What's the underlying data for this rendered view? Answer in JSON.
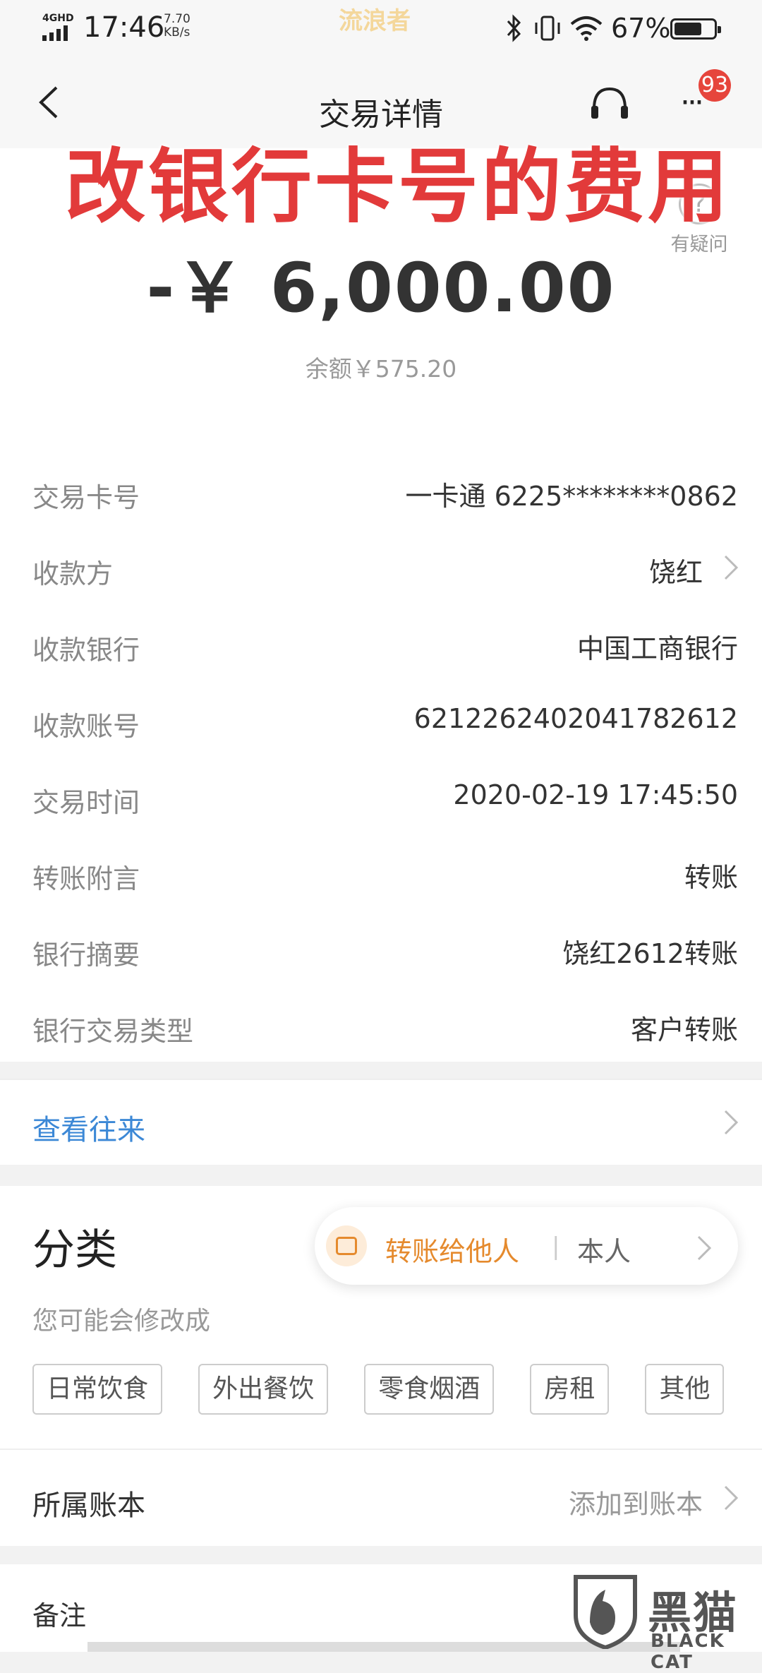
{
  "status_bar": {
    "network": "4GHD",
    "time": "17:46",
    "speed": "7.70",
    "speed_unit": "KB/s",
    "watermark": "流浪者",
    "battery": "67%"
  },
  "nav": {
    "title": "交易详情",
    "badge": "93"
  },
  "overlay": {
    "text": "改银行卡号的费用"
  },
  "help": {
    "label": "有疑问"
  },
  "amount": "-￥ 6,000.00",
  "balance": "余额￥575.20",
  "details": [
    {
      "label": "交易卡号",
      "value": "一卡通 6225********0862"
    },
    {
      "label": "收款方",
      "value": "饶红"
    },
    {
      "label": "收款银行",
      "value": "中国工商银行"
    },
    {
      "label": "收款账号",
      "value": "6212262402041782612"
    },
    {
      "label": "交易时间",
      "value": "2020-02-19 17:45:50"
    },
    {
      "label": "转账附言",
      "value": "转账"
    },
    {
      "label": "银行摘要",
      "value": "饶红2612转账"
    },
    {
      "label": "银行交易类型",
      "value": "客户转账"
    }
  ],
  "view_history": "查看往来",
  "category": {
    "title": "分类",
    "pill_label": "转账给他人",
    "pill_separator": "|",
    "pill_secondary": "本人",
    "hint": "您可能会修改成",
    "tags": [
      "日常饮食",
      "外出餐饮",
      "零食烟酒",
      "房租",
      "其他"
    ]
  },
  "account_book": {
    "label": "所属账本",
    "value": "添加到账本"
  },
  "note": {
    "label": "备注"
  },
  "logo": {
    "cn": "黑猫",
    "en": "BLACK CAT"
  },
  "colors": {
    "accent_link": "#3c88d6",
    "category_orange": "#e58a2d",
    "overlay_red": "#e23a3a",
    "badge_red": "#e6453c"
  }
}
